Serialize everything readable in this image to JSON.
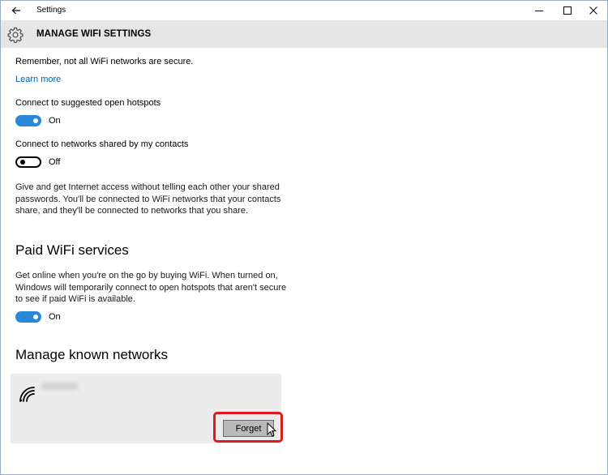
{
  "window": {
    "title": "Settings",
    "back_icon": "back-arrow-icon",
    "minimize_icon": "minimize-icon",
    "maximize_icon": "maximize-icon",
    "close_icon": "close-icon"
  },
  "header": {
    "icon": "gear-icon",
    "title": "MANAGE WIFI SETTINGS"
  },
  "security_note": {
    "text": "Remember, not all WiFi networks are secure.",
    "link": "Learn more"
  },
  "suggested_hotspots": {
    "label": "Connect to suggested open hotspots",
    "state": "On",
    "enabled": true
  },
  "contacts_networks": {
    "label": "Connect to networks shared by my contacts",
    "state": "Off",
    "enabled": false,
    "description": "Give and get Internet access without telling each other your shared passwords. You'll be connected to WiFi networks that your contacts share, and they'll be connected to networks that you share."
  },
  "paid_wifi": {
    "heading": "Paid WiFi services",
    "description": "Get online when you're on the go by buying WiFi. When turned on, Windows will temporarily connect to open hotspots that aren't secure to see if paid WiFi is available.",
    "state": "On",
    "enabled": true
  },
  "known_networks": {
    "heading": "Manage known networks",
    "network_icon": "wifi-signal-icon",
    "forget_label": "Forget"
  },
  "colors": {
    "accent": "#2b88d8",
    "link": "#0063b1",
    "header_bg": "#e6e6e6",
    "highlight": "#e0191c"
  }
}
